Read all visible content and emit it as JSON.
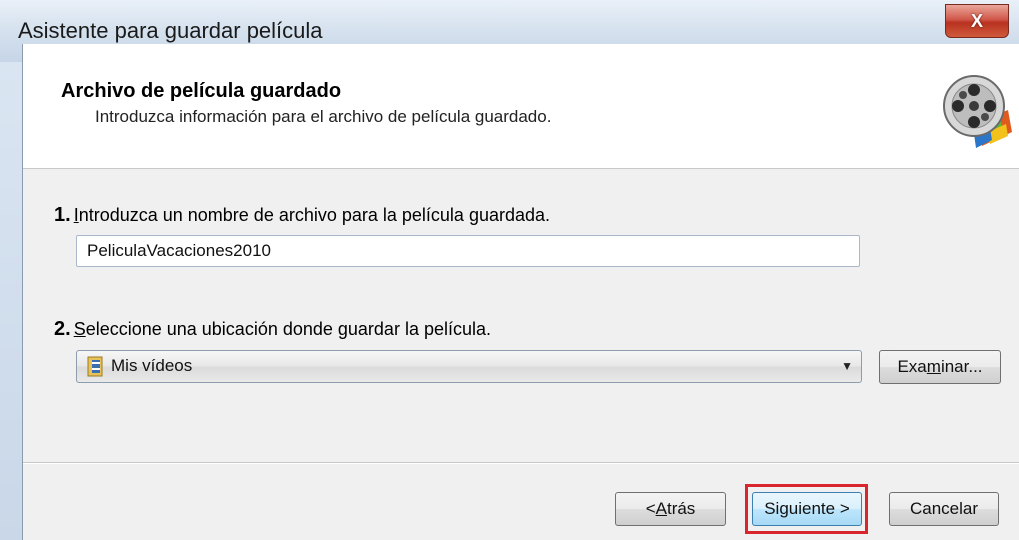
{
  "window": {
    "title": "Asistente para guardar película",
    "close_glyph": "X"
  },
  "header": {
    "title": "Archivo de película guardado",
    "subtitle": "Introduzca información para el archivo de película guardado.",
    "icon": "film-reel-icon"
  },
  "step1": {
    "number": "1.",
    "label_first": "I",
    "label_rest": "ntroduzca un nombre de archivo para la película guardada.",
    "filename_value": "PeliculaVacaciones2010"
  },
  "step2": {
    "number": "2.",
    "label_first": "S",
    "label_rest": "eleccione una ubicación donde guardar la película.",
    "location_value": "Mis vídeos",
    "location_icon": "video-folder-icon",
    "browse_pre": "Exa",
    "browse_u": "m",
    "browse_post": "inar..."
  },
  "footer": {
    "back_pre": "< ",
    "back_u": "A",
    "back_post": "trás",
    "next_label": "Siguiente >",
    "cancel_label": "Cancelar"
  },
  "colors": {
    "highlight": "#d9262c",
    "close_button": "#c8432f"
  }
}
